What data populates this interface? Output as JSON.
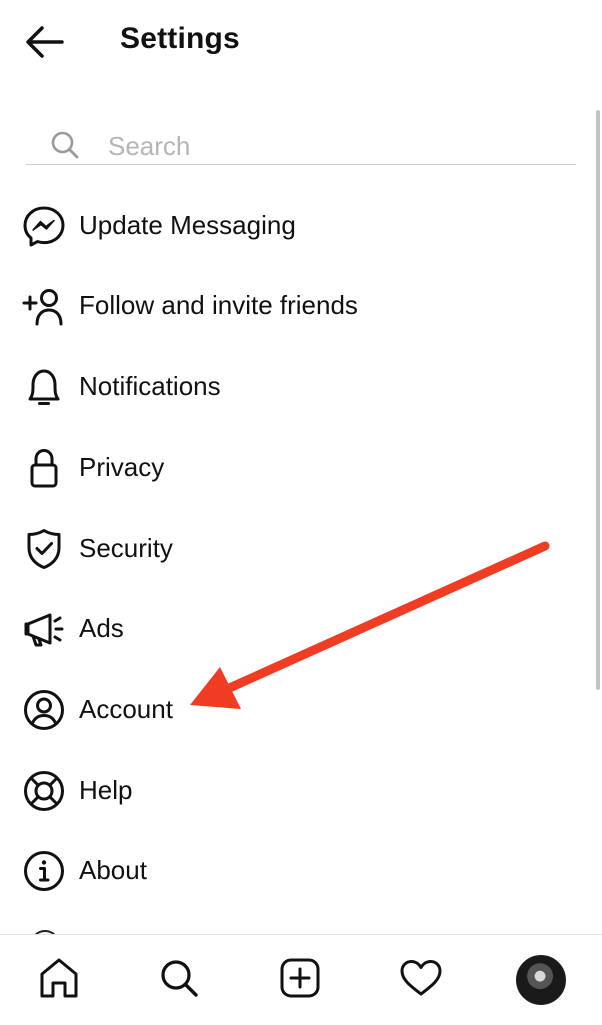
{
  "header": {
    "title": "Settings",
    "back_icon": "arrow-left-icon"
  },
  "search": {
    "placeholder": "Search",
    "value": "",
    "icon": "search-icon"
  },
  "menu": {
    "items": [
      {
        "label": "Update Messaging",
        "icon": "messenger-icon"
      },
      {
        "label": "Follow and invite friends",
        "icon": "add-person-icon"
      },
      {
        "label": "Notifications",
        "icon": "bell-icon"
      },
      {
        "label": "Privacy",
        "icon": "lock-icon"
      },
      {
        "label": "Security",
        "icon": "shield-check-icon"
      },
      {
        "label": "Ads",
        "icon": "megaphone-icon"
      },
      {
        "label": "Account",
        "icon": "user-circle-icon"
      },
      {
        "label": "Help",
        "icon": "lifebuoy-icon"
      },
      {
        "label": "About",
        "icon": "info-icon"
      }
    ]
  },
  "annotation": {
    "type": "arrow",
    "points_to": "Account",
    "color": "#f03c23"
  },
  "tabbar": {
    "tabs": [
      {
        "icon": "home-icon"
      },
      {
        "icon": "search-icon"
      },
      {
        "icon": "new-post-icon"
      },
      {
        "icon": "heart-icon"
      },
      {
        "icon": "profile-avatar"
      }
    ]
  }
}
